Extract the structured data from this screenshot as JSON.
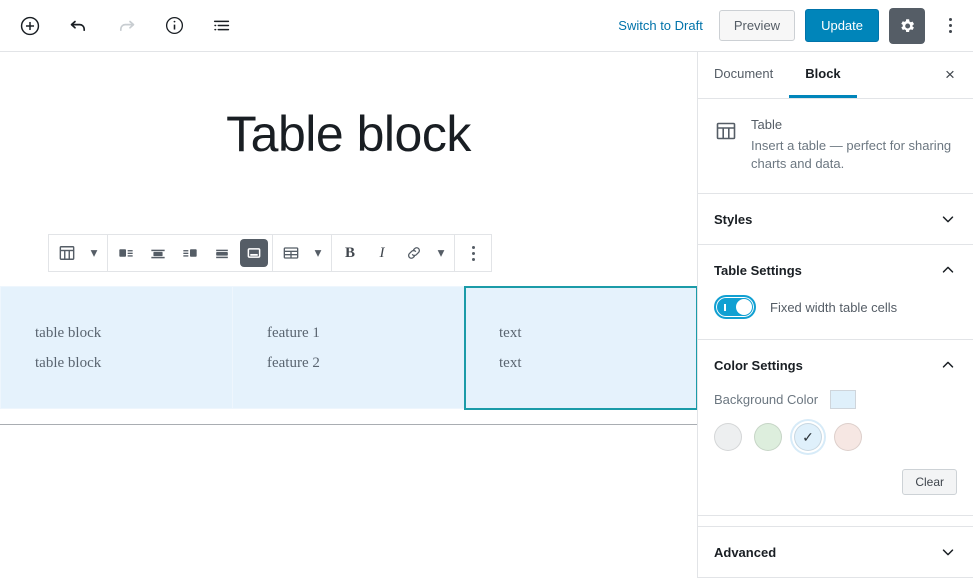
{
  "header": {
    "icons": {
      "add_block": "add-block-icon",
      "undo": "undo-icon",
      "redo": "redo-icon",
      "info": "info-icon",
      "list_view": "list-view-icon",
      "settings_gear": "gear-icon",
      "more_menu": "kebab-menu-icon"
    },
    "switch_to_draft_label": "Switch to Draft",
    "preview_label": "Preview",
    "update_label": "Update",
    "accent_color": "#0085ba",
    "gear_active_bg": "#555d66"
  },
  "block_toolbar": {
    "block_type_icon": "table-icon",
    "block_type_caret": "▾",
    "align_left": "align-left-icon",
    "align_center": "align-center-icon",
    "align_right": "align-right-icon",
    "align_wide": "align-wide-icon",
    "align_full": "align-full-icon",
    "align_full_active": true,
    "edit_table_icon": "edit-table-icon",
    "edit_table_caret": "▾",
    "bold_label": "B",
    "italic_label": "I",
    "link_icon": "link-icon",
    "more_rich_text_caret": "▾",
    "more_options_icon": "kebab-menu-icon"
  },
  "editor": {
    "post_title": "Table block",
    "table": {
      "background_color": "#e5f2fc",
      "selected_cell_border": "#1b9ba8",
      "selected_cell": {
        "row": 0,
        "col": 2
      },
      "rows": [
        [
          [
            "table block",
            "table block"
          ],
          [
            "feature 1",
            "feature 2"
          ],
          [
            "text",
            "text"
          ]
        ]
      ]
    }
  },
  "sidebar": {
    "tabs": [
      {
        "label": "Document",
        "active": false
      },
      {
        "label": "Block",
        "active": true
      }
    ],
    "close_icon": "×",
    "block_card": {
      "icon": "table-icon",
      "title": "Table",
      "description": "Insert a table — perfect for sharing charts and data."
    },
    "panels": [
      {
        "title": "Styles",
        "expanded": false
      },
      {
        "title": "Table Settings",
        "expanded": true
      },
      {
        "title": "Color Settings",
        "expanded": true
      },
      {
        "title": "Advanced",
        "expanded": false
      }
    ],
    "table_settings": {
      "fixed_width_label": "Fixed width table cells",
      "fixed_width_on": true,
      "toggle_color": "#11a0d2"
    },
    "color_settings": {
      "background_color_label": "Background Color",
      "current_swatch": "#dff0fb",
      "swatches": [
        {
          "name": "light-gray",
          "color": "#edeff0",
          "selected": false
        },
        {
          "name": "light-green",
          "color": "#ddeedd",
          "selected": false
        },
        {
          "name": "light-blue",
          "color": "#dff0fb",
          "selected": true
        },
        {
          "name": "light-pink",
          "color": "#f6e7e3",
          "selected": false
        }
      ],
      "check_glyph": "✓",
      "clear_label": "Clear"
    }
  }
}
